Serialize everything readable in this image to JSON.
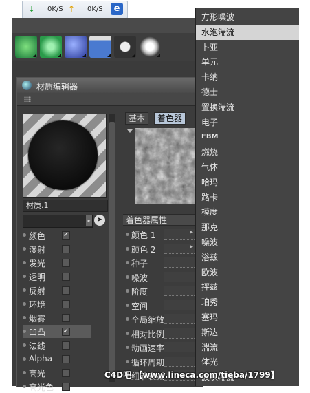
{
  "taskbar": {
    "down_arrow": "↓",
    "down_speed": "0K/S",
    "up_arrow": "↑",
    "up_speed": "0K/S"
  },
  "editor": {
    "title": "材质编辑器",
    "material_name": "材质.1",
    "channels": [
      {
        "label": "颜色",
        "checked": "✓"
      },
      {
        "label": "漫射",
        "checked": ""
      },
      {
        "label": "发光",
        "checked": ""
      },
      {
        "label": "透明",
        "checked": ""
      },
      {
        "label": "反射",
        "checked": ""
      },
      {
        "label": "环境",
        "checked": ""
      },
      {
        "label": "烟雾",
        "checked": ""
      },
      {
        "label": "凹凸",
        "checked": "✓"
      },
      {
        "label": "法线",
        "checked": ""
      },
      {
        "label": "Alpha",
        "checked": ""
      },
      {
        "label": "高光",
        "checked": ""
      },
      {
        "label": "高光色",
        "checked": ""
      }
    ],
    "tabs": [
      "基本",
      "着色器"
    ],
    "properties_header": "着色器属性",
    "properties": [
      {
        "label": "颜色 1",
        "more": "▸"
      },
      {
        "label": "颜色 2",
        "more": "▸"
      },
      {
        "label": "种子",
        "more": ""
      },
      {
        "label": "噪波",
        "more": ""
      },
      {
        "label": "阶度",
        "more": ""
      },
      {
        "label": "空间",
        "more": ""
      },
      {
        "label": "全局缩放",
        "more": ""
      },
      {
        "label": "相对比例",
        "more": ""
      },
      {
        "label": "动画速率",
        "more": ""
      },
      {
        "label": "循环周期",
        "more": ""
      },
      {
        "label": "细节衰减",
        "more": ""
      }
    ]
  },
  "menu": {
    "items": [
      "方形噪波",
      "水泡湍流",
      "卜亚",
      "单元",
      "卡纳",
      "德士",
      "置换湍流",
      "电子",
      "FBM",
      "燃烧",
      "气体",
      "哈玛",
      "路卡",
      "模度",
      "那克",
      "噪波",
      "浴兹",
      "欧波",
      "抨兹",
      "珀秀",
      "塞玛",
      "斯达",
      "湍流",
      "体光",
      "波状湍流"
    ],
    "highlighted": "水泡湍流"
  },
  "watermark": "C4D吧 【www.lineca.com/tieba/1799】",
  "colors": {
    "app_bg": "#3b3b3b",
    "menu_bg": "#444444",
    "menu_highlight": "#d5d5d5",
    "active_tab": "#b8c7d9"
  }
}
